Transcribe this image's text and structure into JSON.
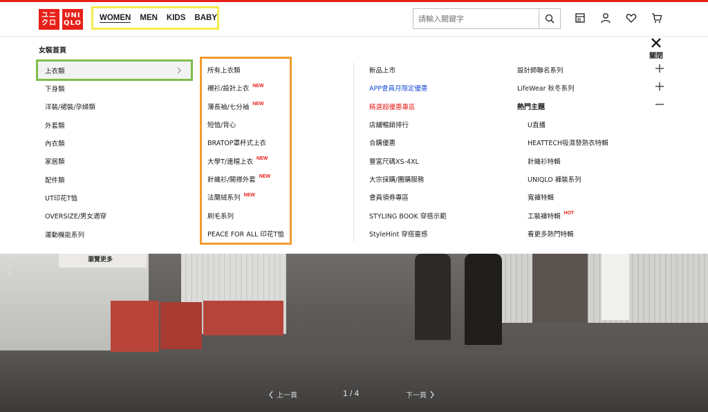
{
  "header": {
    "logo": {
      "line1a": "ユニ",
      "line1b": "クロ",
      "line2a": "UNI",
      "line2b": "QLO"
    },
    "gender_tabs": [
      "WOMEN",
      "MEN",
      "KIDS",
      "BABY"
    ],
    "search": {
      "placeholder": "請輸入關鍵字",
      "value": ""
    },
    "icons": [
      "store-icon",
      "user-icon",
      "heart-icon",
      "cart-icon"
    ]
  },
  "menu": {
    "title": "女裝首頁",
    "close_label": "關閉",
    "categories": [
      "上衣類",
      "下身類",
      "洋裝/裙裝/孕婦類",
      "外套類",
      "內衣類",
      "家居類",
      "配件類",
      "UT印花T恤",
      "OVERSIZE/男女適穿",
      "運動機能系列"
    ],
    "selected_category": "上衣類",
    "subcategories": [
      {
        "label": "所有上衣類",
        "badge": ""
      },
      {
        "label": "襯衫/設計上衣",
        "badge": "NEW"
      },
      {
        "label": "薄長袖/七分袖",
        "badge": "NEW"
      },
      {
        "label": "短恤/背心",
        "badge": ""
      },
      {
        "label": "BRATOP罩杯式上衣",
        "badge": ""
      },
      {
        "label": "大學T/連帽上衣",
        "badge": "NEW"
      },
      {
        "label": "針織衫/開襟外套",
        "badge": "NEW"
      },
      {
        "label": "法蘭絨系列",
        "badge": "NEW"
      },
      {
        "label": "刷毛系列",
        "badge": ""
      },
      {
        "label": "PEACE FOR ALL 印花T恤",
        "badge": ""
      }
    ],
    "promos": [
      {
        "label": "新品上市",
        "style": "normal"
      },
      {
        "label": "APP會員月限定優惠",
        "style": "blue"
      },
      {
        "label": "精選超優惠專區",
        "style": "red"
      },
      {
        "label": "店舖暢銷排行",
        "style": "normal"
      },
      {
        "label": "合購優惠",
        "style": "normal"
      },
      {
        "label": "豐富尺碼XS-4XL",
        "style": "normal"
      },
      {
        "label": "大宗採購/團購服務",
        "style": "normal"
      },
      {
        "label": "會員領券專區",
        "style": "normal"
      },
      {
        "label": "STYLING BOOK 穿搭示範",
        "style": "normal"
      },
      {
        "label": "StyleHint 穿搭靈感",
        "style": "normal"
      }
    ],
    "features": [
      {
        "label": "設計師聯名系列",
        "style": "normal",
        "badge": ""
      },
      {
        "label": "LifeWear 秋冬系列",
        "style": "normal",
        "badge": ""
      },
      {
        "label": "熱門主題",
        "style": "bold",
        "badge": ""
      },
      {
        "label": "U直播",
        "style": "indent",
        "badge": ""
      },
      {
        "label": "HEATTECH吸濕發熱衣特輯",
        "style": "indent",
        "badge": ""
      },
      {
        "label": "針織衫特輯",
        "style": "indent",
        "badge": ""
      },
      {
        "label": "UNIQLO 褲裝系列",
        "style": "indent",
        "badge": ""
      },
      {
        "label": "寬褲特輯",
        "style": "indent",
        "badge": ""
      },
      {
        "label": "工裝褲特輯",
        "style": "indent",
        "badge": "HOT"
      },
      {
        "label": "看更多熱門特輯",
        "style": "indent",
        "badge": ""
      }
    ],
    "expanders": [
      "+",
      "+",
      "−"
    ]
  },
  "hero": {
    "card_text": "瀏覽更多",
    "prev_label": "上一頁",
    "next_label": "下一頁",
    "pager": "1 / 4"
  },
  "colors": {
    "brand_red": "#e7211a",
    "highlight_yellow": "#f2ec4b",
    "highlight_green": "#7fbc48",
    "highlight_orange": "#f39b2d",
    "link_blue": "#1a4fd8"
  }
}
